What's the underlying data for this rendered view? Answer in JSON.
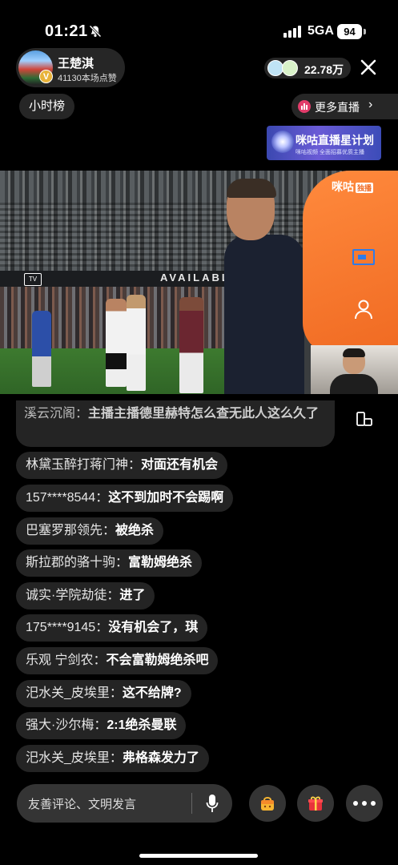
{
  "status_bar": {
    "time": "01:21",
    "network": "5GA",
    "battery": "94"
  },
  "host": {
    "name": "王楚淇",
    "likes": "41130本场点赞",
    "badge": "V"
  },
  "viewers": {
    "count": "22.78万"
  },
  "hour_rank": {
    "label": "小时榜"
  },
  "more_live": {
    "label": "更多直播"
  },
  "banner": {
    "title": "咪咕直播星计划",
    "subtitle": "咪咕视频 全面招募优质主播"
  },
  "video": {
    "board_text": "AVAILABLE",
    "tv_logo": "TV",
    "brand": "咪咕",
    "brand_tag": "独播"
  },
  "chat": {
    "messages": [
      {
        "user": "溪云沉阁：",
        "text": "主播主播德里赫特怎么查无此人这么久了"
      },
      {
        "user": "林黛玉醉打蒋门神：",
        "text": "对面还有机会"
      },
      {
        "user": "157****8544：",
        "text": "这不到加时不会踢啊"
      },
      {
        "user": "巴塞罗那领先：",
        "text": "被绝杀"
      },
      {
        "user": "斯拉郡的骆十驹：",
        "text": "富勒姆绝杀"
      },
      {
        "user": "诚实·学院劫徒：",
        "text": "进了"
      },
      {
        "user": "175****9145：",
        "text": "没有机会了，琪"
      },
      {
        "user": "乐观 宁剑农：",
        "text": "不会富勒姆绝杀吧"
      },
      {
        "user": "汜水关_皮埃里：",
        "text": "这不给牌?"
      },
      {
        "user": "强大·沙尔梅：",
        "text": "2:1绝杀曼联"
      },
      {
        "user": "汜水关_皮埃里：",
        "text": "弗格森发力了"
      }
    ]
  },
  "input": {
    "placeholder": "友善评论、文明发言"
  },
  "icons": {
    "bell": "bell-slash-icon",
    "close": "close-icon",
    "mic": "mic-icon",
    "gift1": "gift-bag-icon",
    "gift2": "gift-box-icon",
    "more": "more-icon",
    "pip": "picture-in-picture-icon",
    "person": "person-icon",
    "rotate": "rotate-screen-icon"
  },
  "colors": {
    "accent_orange": "#f06a22",
    "pip_blue": "#2f7be8",
    "live_pink": "#e23c6a"
  }
}
